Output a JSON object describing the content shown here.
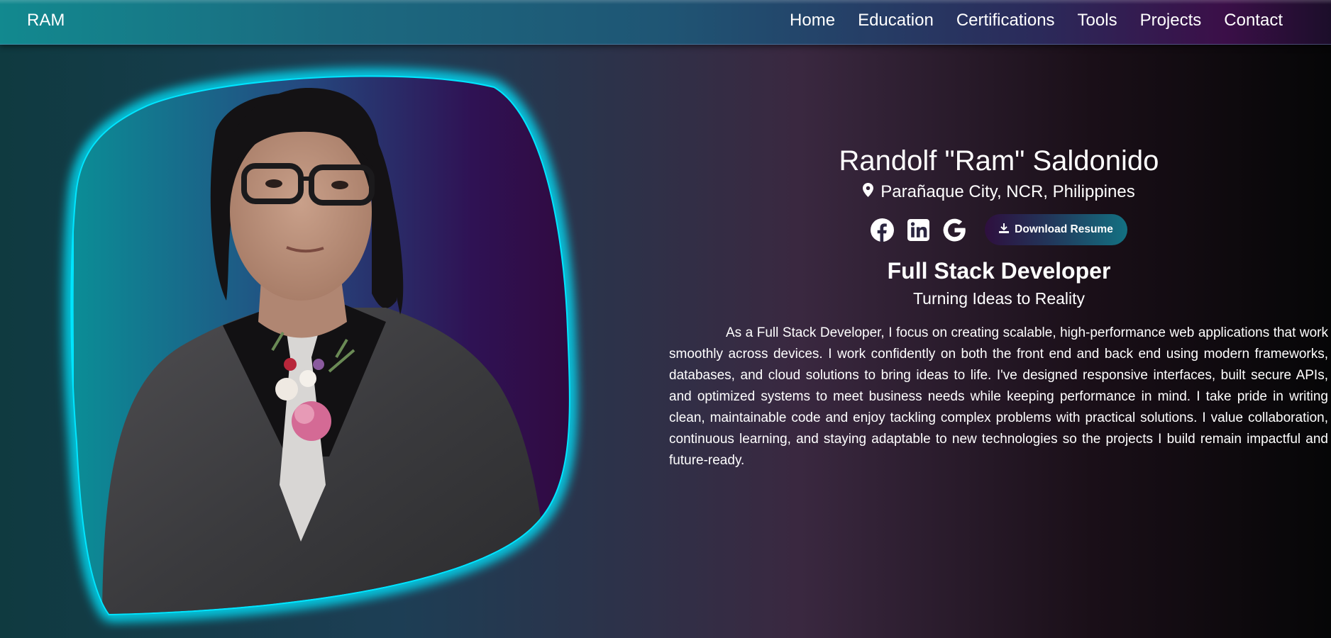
{
  "nav": {
    "brand": "RAM",
    "links": [
      "Home",
      "Education",
      "Certifications",
      "Tools",
      "Projects",
      "Contact"
    ]
  },
  "hero": {
    "name": "Randolf \"Ram\" Saldonido",
    "location": "Parañaque City, NCR, Philippines",
    "location_icon": "map-pin-icon",
    "socials": [
      "facebook-icon",
      "linkedin-icon",
      "google-icon"
    ],
    "resume_label": "Download Resume",
    "resume_icon": "download-icon",
    "role": "Full Stack Developer",
    "tagline": "Turning Ideas to Reality",
    "bio": "As a Full Stack Developer, I focus on creating scalable, high-performance web applications that work smoothly across devices. I work confidently on both the front end and back end using modern frameworks, databases, and cloud solutions to bring ideas to life. I've designed responsive interfaces, built secure APIs, and optimized systems to meet business needs while keeping performance in mind. I take pride in writing clean, maintainable code and enjoy tackling complex problems with practical solutions. I value collaboration, continuous learning, and staying adaptable to new technologies so the projects I build remain impactful and future-ready."
  },
  "colors": {
    "glow": "#00e5ff",
    "button_start": "#2e0f3e",
    "button_end": "#137182"
  }
}
